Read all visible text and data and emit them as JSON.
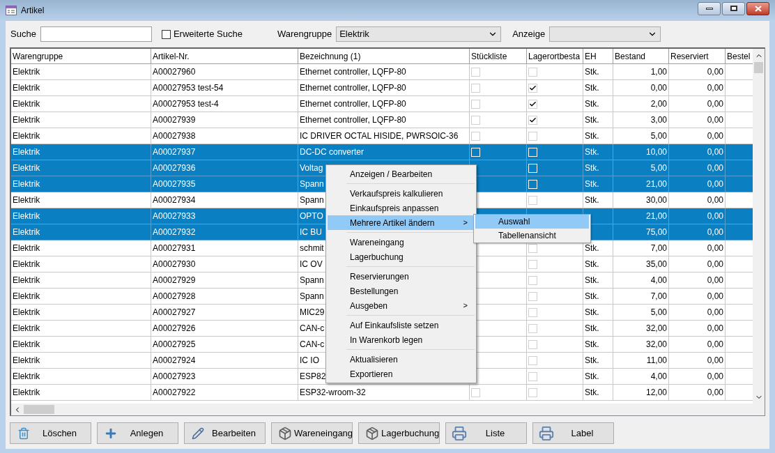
{
  "window": {
    "title": "Artikel"
  },
  "filters": {
    "search_label": "Suche",
    "extended": {
      "label": "Erweiterte Suche",
      "checked": false
    },
    "group_label": "Warengruppe",
    "group_value": "Elektrik",
    "view_label": "Anzeige"
  },
  "table": {
    "columns": [
      {
        "label": "Warengruppe",
        "kind": "text"
      },
      {
        "label": "Artikel-Nr.",
        "kind": "text"
      },
      {
        "label": "Bezeichnung (1)",
        "kind": "text"
      },
      {
        "label": "Stückliste",
        "kind": "check"
      },
      {
        "label": "Lagerortbesta",
        "kind": "check"
      },
      {
        "label": "EH",
        "kind": "text"
      },
      {
        "label": "Bestand",
        "kind": "num"
      },
      {
        "label": "Reserviert",
        "kind": "num"
      },
      {
        "label": "Bestel",
        "kind": "num"
      }
    ],
    "rows": [
      {
        "selected": false,
        "cells": [
          "Elektrik",
          "A00027960",
          "Ethernet controller, LQFP-80",
          {
            "checked": false
          },
          {
            "checked": false
          },
          "Stk.",
          "1,00",
          "0,00"
        ]
      },
      {
        "selected": false,
        "cells": [
          "Elektrik",
          "A00027953 test-54",
          "Ethernet controller, LQFP-80",
          {
            "checked": false
          },
          {
            "checked": true
          },
          "Stk.",
          "0,00",
          "0,00"
        ]
      },
      {
        "selected": false,
        "cells": [
          "Elektrik",
          "A00027953 test-4",
          "Ethernet controller, LQFP-80",
          {
            "checked": false
          },
          {
            "checked": true
          },
          "Stk.",
          "2,00",
          "0,00"
        ]
      },
      {
        "selected": false,
        "cells": [
          "Elektrik",
          "A00027939",
          "Ethernet controller, LQFP-80",
          {
            "checked": false
          },
          {
            "checked": true
          },
          "Stk.",
          "3,00",
          "0,00"
        ]
      },
      {
        "selected": false,
        "cells": [
          "Elektrik",
          "A00027938",
          "IC DRIVER OCTAL HISIDE, PWRSOIC-36",
          {
            "checked": false
          },
          {
            "checked": false
          },
          "Stk.",
          "5,00",
          "0,00"
        ]
      },
      {
        "selected": true,
        "cells": [
          "Elektrik",
          "A00027937",
          "DC-DC converter",
          {
            "checked": false
          },
          {
            "checked": false
          },
          "Stk.",
          "10,00",
          "0,00"
        ]
      },
      {
        "selected": true,
        "cells": [
          "Elektrik",
          "A00027936",
          "Voltag",
          null,
          {
            "checked": false
          },
          "Stk.",
          "5,00",
          "0,00"
        ]
      },
      {
        "selected": true,
        "cells": [
          "Elektrik",
          "A00027935",
          "Spann",
          null,
          {
            "checked": false
          },
          "Stk.",
          "21,00",
          "0,00"
        ]
      },
      {
        "selected": false,
        "cells": [
          "Elektrik",
          "A00027934",
          "Spann",
          null,
          {
            "checked": false
          },
          "Stk.",
          "30,00",
          "0,00"
        ]
      },
      {
        "selected": true,
        "cells": [
          "Elektrik",
          "A00027933",
          "OPTO",
          null,
          null,
          "",
          "21,00",
          "0,00"
        ]
      },
      {
        "selected": true,
        "cells": [
          "Elektrik",
          "A00027932",
          "IC BU",
          null,
          null,
          "",
          "75,00",
          "0,00"
        ]
      },
      {
        "selected": false,
        "cells": [
          "Elektrik",
          "A00027931",
          "schmit",
          null,
          {
            "checked": false
          },
          "Stk.",
          "7,00",
          "0,00"
        ]
      },
      {
        "selected": false,
        "cells": [
          "Elektrik",
          "A00027930",
          "IC OV",
          null,
          {
            "checked": false
          },
          "Stk.",
          "35,00",
          "0,00"
        ]
      },
      {
        "selected": false,
        "cells": [
          "Elektrik",
          "A00027929",
          "Spann",
          null,
          {
            "checked": false
          },
          "Stk.",
          "4,00",
          "0,00"
        ]
      },
      {
        "selected": false,
        "cells": [
          "Elektrik",
          "A00027928",
          "Spann",
          null,
          {
            "checked": false
          },
          "Stk.",
          "7,00",
          "0,00"
        ]
      },
      {
        "selected": false,
        "cells": [
          "Elektrik",
          "A00027927",
          "MIC29",
          null,
          {
            "checked": false
          },
          "Stk.",
          "5,00",
          "0,00"
        ]
      },
      {
        "selected": false,
        "cells": [
          "Elektrik",
          "A00027926",
          "CAN-c",
          null,
          {
            "checked": false
          },
          "Stk.",
          "32,00",
          "0,00"
        ]
      },
      {
        "selected": false,
        "cells": [
          "Elektrik",
          "A00027925",
          "CAN-c",
          null,
          {
            "checked": false
          },
          "Stk.",
          "32,00",
          "0,00"
        ]
      },
      {
        "selected": false,
        "cells": [
          "Elektrik",
          "A00027924",
          "IC IO",
          null,
          {
            "checked": false
          },
          "Stk.",
          "11,00",
          "0,00"
        ]
      },
      {
        "selected": false,
        "cells": [
          "Elektrik",
          "A00027923",
          "ESP82",
          null,
          {
            "checked": false
          },
          "Stk.",
          "4,00",
          "0,00"
        ]
      },
      {
        "selected": false,
        "cells": [
          "Elektrik",
          "A00027922",
          "ESP32-wroom-32",
          {
            "checked": false
          },
          {
            "checked": false
          },
          "Stk.",
          "12,00",
          "0,00"
        ]
      }
    ]
  },
  "context_menu": {
    "groups": [
      [
        {
          "label": "Anzeigen / Bearbeiten",
          "selected": false,
          "submenu": false
        }
      ],
      [
        {
          "label": "Verkaufspreis kalkulieren",
          "selected": false,
          "submenu": false
        },
        {
          "label": "Einkaufspreis anpassen",
          "selected": false,
          "submenu": false
        },
        {
          "label": "Mehrere Artikel ändern",
          "selected": true,
          "submenu": true
        }
      ],
      [
        {
          "label": "Wareneingang",
          "selected": false,
          "submenu": false
        },
        {
          "label": "Lagerbuchung",
          "selected": false,
          "submenu": false
        }
      ],
      [
        {
          "label": "Reservierungen",
          "selected": false,
          "submenu": false
        },
        {
          "label": "Bestellungen",
          "selected": false,
          "submenu": false
        },
        {
          "label": "Ausgeben",
          "selected": false,
          "submenu": true
        }
      ],
      [
        {
          "label": "Auf Einkaufsliste setzen",
          "selected": false,
          "submenu": false
        },
        {
          "label": "In Warenkorb legen",
          "selected": false,
          "submenu": false
        }
      ],
      [
        {
          "label": "Aktualisieren",
          "selected": false,
          "submenu": false
        },
        {
          "label": "Exportieren",
          "selected": false,
          "submenu": false
        }
      ]
    ],
    "submenu_arrow": ">",
    "submenu": [
      {
        "label": "Auswahl",
        "selected": true
      },
      {
        "label": "Tabellenansicht",
        "selected": false
      }
    ]
  },
  "buttons": [
    {
      "label": "Löschen"
    },
    {
      "label": "Anlegen"
    },
    {
      "label": "Bearbeiten"
    },
    {
      "label": "Wareneingang"
    },
    {
      "label": "Lagerbuchung"
    },
    {
      "label": "Liste"
    },
    {
      "label": "Label"
    }
  ]
}
